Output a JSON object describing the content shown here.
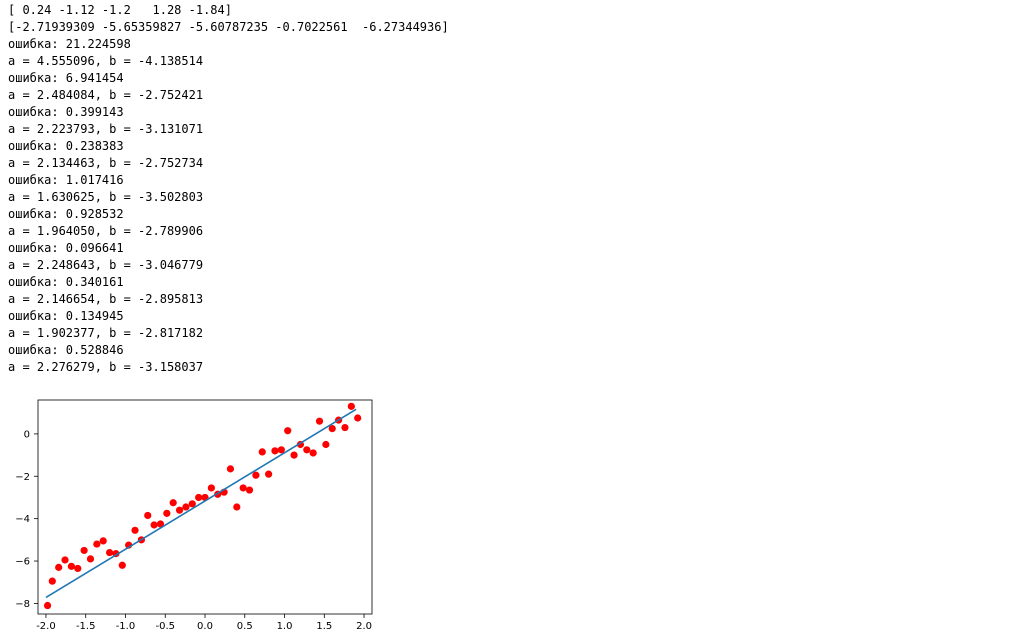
{
  "output_lines": [
    "[ 0.24 -1.12 -1.2   1.28 -1.84]",
    "[-2.71939309 -5.65359827 -5.60787235 -0.7022561  -6.27344936]",
    "ошибка: 21.224598",
    "a = 4.555096, b = -4.138514",
    "ошибка: 6.941454",
    "a = 2.484084, b = -2.752421",
    "ошибка: 0.399143",
    "a = 2.223793, b = -3.131071",
    "ошибка: 0.238383",
    "a = 2.134463, b = -2.752734",
    "ошибка: 1.017416",
    "a = 1.630625, b = -3.502803",
    "ошибка: 0.928532",
    "a = 1.964050, b = -2.789906",
    "ошибка: 0.096641",
    "a = 2.248643, b = -3.046779",
    "ошибка: 0.340161",
    "a = 2.146654, b = -2.895813",
    "ошибка: 0.134945",
    "a = 1.902377, b = -2.817182",
    "ошибка: 0.528846",
    "a = 2.276279, b = -3.158037"
  ],
  "colors": {
    "points": "#ff0000",
    "line": "#1f77b4"
  },
  "chart_data": {
    "type": "scatter",
    "xlim": [
      -2.1,
      2.1
    ],
    "ylim": [
      -8.5,
      1.6
    ],
    "xticks": [
      -2.0,
      -1.5,
      -1.0,
      -0.5,
      0.0,
      0.5,
      1.0,
      1.5,
      2.0
    ],
    "xtick_labels": [
      "-2.0",
      "-1.5",
      "-1.0",
      "-0.5",
      "0.0",
      "0.5",
      "1.0",
      "1.5",
      "2.0"
    ],
    "yticks": [
      0,
      -2,
      -4,
      -6,
      -8
    ],
    "ytick_labels": [
      "0",
      "−2",
      "−4",
      "−6",
      "−8"
    ],
    "grid": false,
    "points": [
      [
        -1.98,
        -8.1
      ],
      [
        -1.92,
        -6.95
      ],
      [
        -1.84,
        -6.3
      ],
      [
        -1.76,
        -5.95
      ],
      [
        -1.68,
        -6.25
      ],
      [
        -1.6,
        -6.35
      ],
      [
        -1.52,
        -5.5
      ],
      [
        -1.44,
        -5.9
      ],
      [
        -1.36,
        -5.2
      ],
      [
        -1.28,
        -5.05
      ],
      [
        -1.2,
        -5.6
      ],
      [
        -1.12,
        -5.65
      ],
      [
        -1.04,
        -6.2
      ],
      [
        -0.96,
        -5.25
      ],
      [
        -0.88,
        -4.55
      ],
      [
        -0.8,
        -5.0
      ],
      [
        -0.72,
        -3.85
      ],
      [
        -0.64,
        -4.3
      ],
      [
        -0.56,
        -4.25
      ],
      [
        -0.48,
        -3.75
      ],
      [
        -0.4,
        -3.25
      ],
      [
        -0.32,
        -3.6
      ],
      [
        -0.24,
        -3.45
      ],
      [
        -0.16,
        -3.3
      ],
      [
        -0.08,
        -3.0
      ],
      [
        0.0,
        -3.0
      ],
      [
        0.08,
        -2.55
      ],
      [
        0.16,
        -2.85
      ],
      [
        0.24,
        -2.75
      ],
      [
        0.32,
        -1.65
      ],
      [
        0.4,
        -3.45
      ],
      [
        0.48,
        -2.55
      ],
      [
        0.56,
        -2.65
      ],
      [
        0.64,
        -1.95
      ],
      [
        0.72,
        -0.85
      ],
      [
        0.8,
        -1.9
      ],
      [
        0.88,
        -0.8
      ],
      [
        0.96,
        -0.75
      ],
      [
        1.04,
        0.15
      ],
      [
        1.12,
        -1.0
      ],
      [
        1.2,
        -0.5
      ],
      [
        1.28,
        -0.75
      ],
      [
        1.36,
        -0.9
      ],
      [
        1.44,
        0.6
      ],
      [
        1.52,
        -0.5
      ],
      [
        1.6,
        0.25
      ],
      [
        1.68,
        0.65
      ],
      [
        1.76,
        0.3
      ],
      [
        1.84,
        1.3
      ],
      [
        1.92,
        0.75
      ]
    ],
    "fit_line": {
      "x": [
        -2.0,
        1.9
      ],
      "y": [
        -7.72,
        1.16
      ]
    }
  }
}
